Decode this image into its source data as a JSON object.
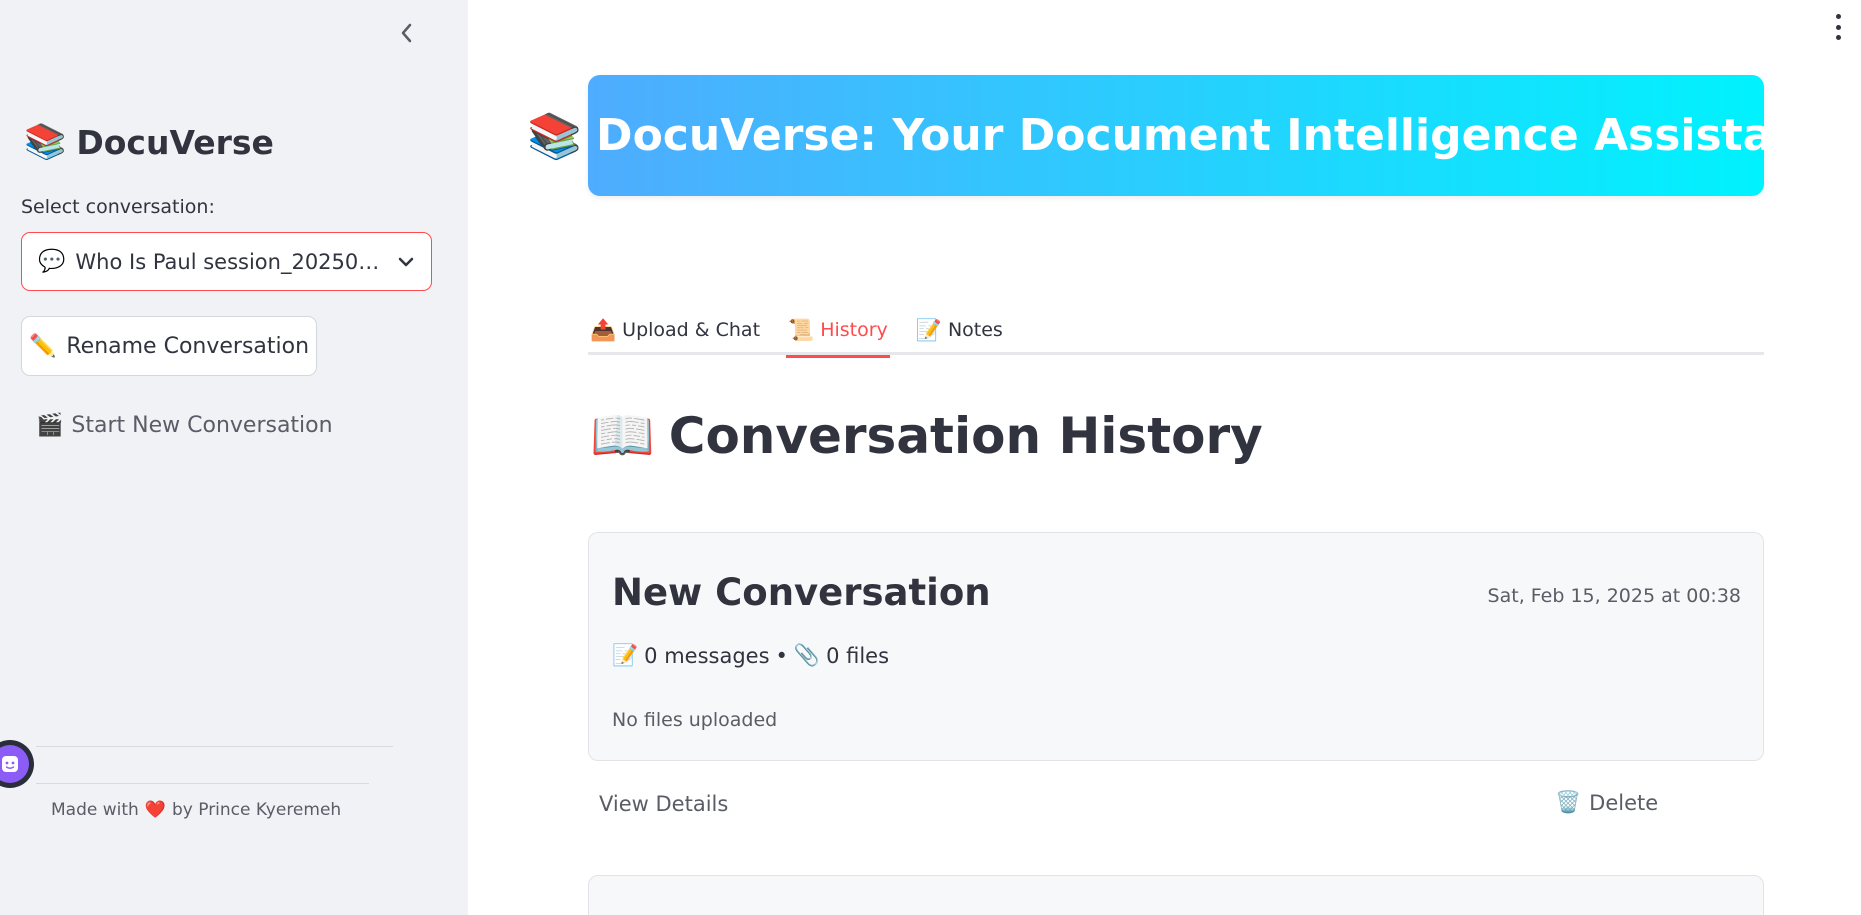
{
  "sidebar": {
    "title": "DocuVerse",
    "title_icon": "books-icon",
    "select_label": "Select conversation:",
    "select_value": "Who Is Paul session_20250…",
    "rename_label": "Rename Conversation",
    "new_conversation_label": "Start New Conversation",
    "footer_made_with": "Made with",
    "footer_by": "by Prince Kyeremeh"
  },
  "header": {
    "title": "DocuVerse: Your Document Intelligence Assistant",
    "gradient_start": "#4facfe",
    "gradient_end": "#00f2fe"
  },
  "tabs": [
    {
      "label": "Upload & Chat",
      "icon": "outbox-tray-icon",
      "active": false
    },
    {
      "label": "History",
      "icon": "scroll-icon",
      "active": true
    },
    {
      "label": "Notes",
      "icon": "memo-icon",
      "active": false
    }
  ],
  "main": {
    "section_title": "Conversation History",
    "conversations": [
      {
        "title": "New Conversation",
        "date": "Sat, Feb 15, 2025 at 00:38",
        "messages": "0 messages",
        "separator": "•",
        "files": "0 files",
        "files_note": "No files uploaded",
        "view_details_label": "View Details",
        "delete_label": "Delete"
      }
    ]
  },
  "colors": {
    "accent": "#ff4b4b",
    "sidebar_bg": "#f0f2f6",
    "text": "#31333f"
  }
}
